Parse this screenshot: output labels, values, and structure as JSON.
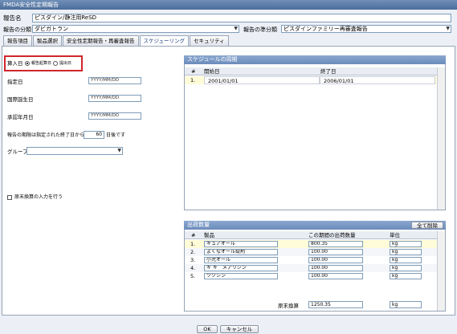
{
  "window": {
    "title": "FMDA安全性定期報告"
  },
  "header": {
    "report_name_label": "報告名",
    "report_name_value": "ピスダイン/静注用ReSD",
    "category_label": "報告の分類",
    "category_value": "ダビガトラン",
    "subcategory_label": "報告の準分類",
    "subcategory_value": "ピスダインファミリー再審査報告"
  },
  "tabs": [
    {
      "label": "報告項目"
    },
    {
      "label": "製品選択"
    },
    {
      "label": "安全性定期報告・再審査報告"
    },
    {
      "label": "スケジューリング"
    },
    {
      "label": "セキュリティ"
    }
  ],
  "left": {
    "entry_label": "算入日",
    "radio1": "報告起算日",
    "radio2": "提出日",
    "designated_label": "指定日",
    "designated_placeholder": "YYYY/MM/DD",
    "intl_birth_label": "国際誕生日",
    "intl_birth_placeholder": "YYYY/MM/DD",
    "approval_label": "承認年月日",
    "approval_placeholder": "YYYY/MM/DD",
    "deadline_prefix": "報告の期限は指定された終了日から",
    "deadline_days": "60",
    "deadline_suffix": "日後です",
    "group_label": "グループ",
    "group_value": "",
    "bulk_label": "原末換算の入力を行う"
  },
  "schedule": {
    "title": "スケジュールの周期",
    "col_num": "#",
    "col_start": "開始日",
    "col_end": "終了日",
    "rows": [
      {
        "num": "1.",
        "start": "2001/01/01",
        "end": "2006/01/01"
      }
    ]
  },
  "shipment": {
    "title": "出荷数量",
    "delete_all": "全て削除",
    "col_num": "#",
    "col_product": "製品",
    "col_qty": "この期間の出荷数量",
    "col_unit": "単位",
    "rows": [
      {
        "num": "1.",
        "product": "キュアオール",
        "qty": "800.35",
        "unit": "kg"
      },
      {
        "num": "2.",
        "product": "よくなオール錠剤",
        "qty": "100.00",
        "unit": "kg"
      },
      {
        "num": "3.",
        "product": "小児オール",
        "qty": "100.00",
        "unit": "kg"
      },
      {
        "num": "4.",
        "product": "キ キ゛メアリジン",
        "qty": "100.00",
        "unit": "kg"
      },
      {
        "num": "5.",
        "product": "ツクシン",
        "qty": "100.00",
        "unit": "kg"
      }
    ],
    "total_label": "原末換算",
    "total_value": "1250.35",
    "total_unit": "kg"
  },
  "footer": {
    "ok": "OK",
    "cancel": "キャンセル"
  }
}
